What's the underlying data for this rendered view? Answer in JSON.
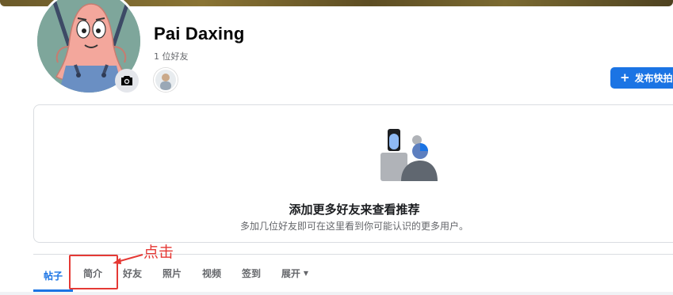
{
  "profile": {
    "name": "Pai Daxing",
    "friend_count": "1 位好友"
  },
  "actions": {
    "add_story_label": "发布快拍"
  },
  "suggestions": {
    "title": "添加更多好友来查看推荐",
    "subtitle": "多加几位好友即可在这里看到你可能认识的更多用户。"
  },
  "tabs": [
    {
      "label": "帖子",
      "active": true
    },
    {
      "label": "简介",
      "active": false
    },
    {
      "label": "好友",
      "active": false
    },
    {
      "label": "照片",
      "active": false
    },
    {
      "label": "视频",
      "active": false
    },
    {
      "label": "签到",
      "active": false
    },
    {
      "label": "展开",
      "active": false
    }
  ],
  "annotation": {
    "label": "点击"
  },
  "colors": {
    "accent": "#1b74e4",
    "annotation": "#e53935",
    "avatar_bg": "#7ea69b"
  }
}
